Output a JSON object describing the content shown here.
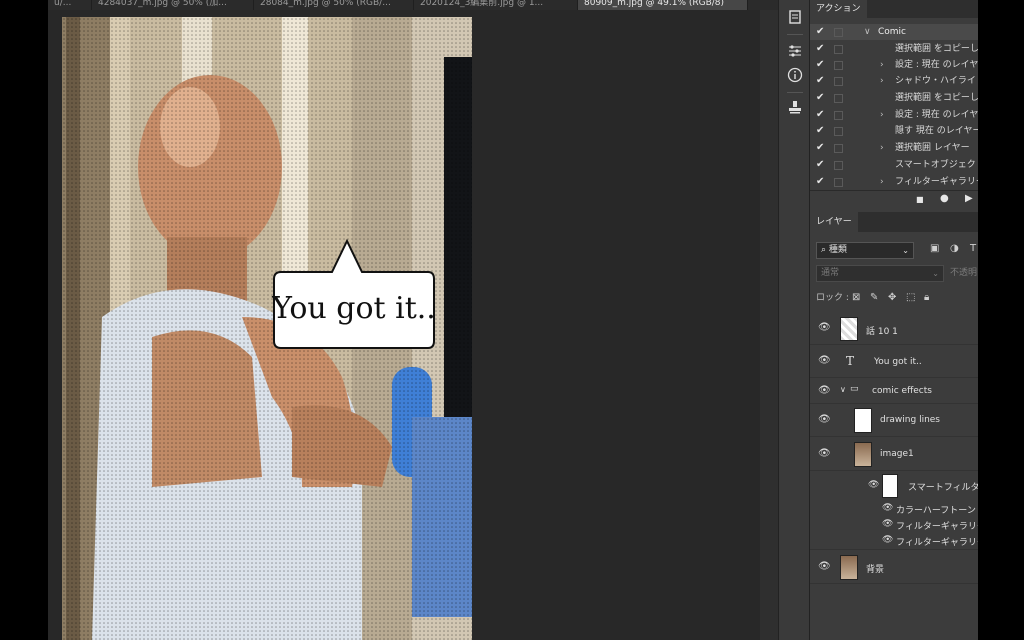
{
  "tabs": [
    {
      "label": "u/..."
    },
    {
      "label": "4284037_m.jpg @ 50% (加..."
    },
    {
      "label": "28084_m.jpg @ 50% (RGB/..."
    },
    {
      "label": "2020124_3編集前.jpg @ 1..."
    },
    {
      "label": "80909_m.jpg @ 49.1% (RGB/8)",
      "active": true
    }
  ],
  "canvas": {
    "speech_text": "You got it.."
  },
  "toolstrip": {
    "icons": [
      "history-icon",
      "adjustments-icon",
      "info-icon",
      "stamp-icon"
    ]
  },
  "actions_panel": {
    "tab": "アクション",
    "rows": [
      {
        "label": "Comic",
        "type": "set",
        "expanded": true
      },
      {
        "label": "選択範囲 をコピーした",
        "type": "step"
      },
      {
        "label": "設定 : 現在 のレイヤー",
        "type": "step",
        "expandable": true
      },
      {
        "label": "シャドウ・ハイライト",
        "type": "step",
        "expandable": true
      },
      {
        "label": "選択範囲 をコピーした",
        "type": "step"
      },
      {
        "label": "設定 : 現在 のレイヤー",
        "type": "step",
        "expandable": true
      },
      {
        "label": "隠す 現在 のレイヤー",
        "type": "step"
      },
      {
        "label": "選択範囲 レイヤー",
        "type": "step",
        "expandable": true
      },
      {
        "label": "スマートオブジェクトに",
        "type": "step"
      },
      {
        "label": "フィルターギャラリー",
        "type": "step",
        "expandable": true
      }
    ],
    "controls": [
      "stop-icon",
      "record-icon",
      "play-icon"
    ]
  },
  "layers_panel": {
    "tab": "レイヤー",
    "filter_label": "種類",
    "blend_mode": "通常",
    "opacity_label": "不透明",
    "lock_label": "ロック :",
    "layers": [
      {
        "name": "話 10 1",
        "kind": "smart"
      },
      {
        "name": "You got it..",
        "kind": "text"
      },
      {
        "name": "comic effects",
        "kind": "group"
      },
      {
        "name": "drawing lines",
        "kind": "pixel"
      },
      {
        "name": "image1",
        "kind": "smart"
      },
      {
        "name": "スマートフィルター",
        "kind": "smart-filter"
      },
      {
        "name": "カラーハーフトーン",
        "kind": "filter"
      },
      {
        "name": "フィルターギャラリー",
        "kind": "filter"
      },
      {
        "name": "フィルターギャラリー",
        "kind": "filter"
      },
      {
        "name": "背景",
        "kind": "background"
      }
    ]
  }
}
